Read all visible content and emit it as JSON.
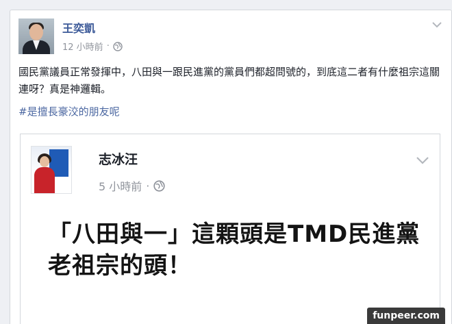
{
  "post": {
    "author_name": "王奕凱",
    "timestamp": "12 小時前",
    "privacy_separator": "·",
    "text": "國民黨議員正常發揮中，八田與一跟民進黨的黨員們都超問號的，到底這二者有什麼祖宗這關連呀？真是神邏輯。",
    "hashtag": "#是擅長豪洨的朋友呢",
    "shared_post": {
      "author_name": "志冰汪",
      "timestamp": "5 小時前",
      "privacy_separator": "·",
      "content": "「八田與一」這顆頭是TMD民進黨老祖宗的頭！"
    }
  },
  "watermark": "funpeer.com",
  "icons": {
    "privacy": "globe-icon",
    "options": "chevron-down-icon"
  },
  "colors": {
    "author_link": "#3b5998",
    "hashtag": "#4b67a1",
    "meta": "#90949c"
  }
}
